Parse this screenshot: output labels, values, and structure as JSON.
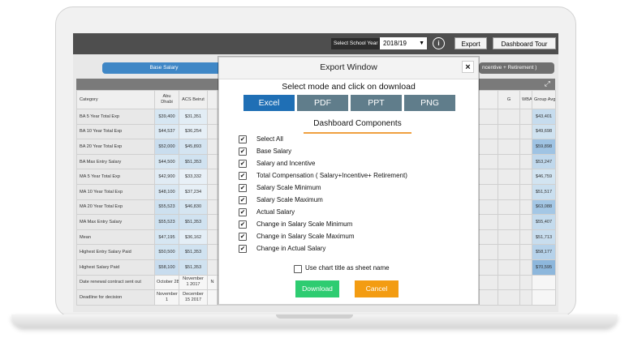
{
  "topbar": {
    "school_year_label": "Select School Year",
    "school_year_value": "2018/19",
    "export_label": "Export",
    "tour_label": "Dashboard Tour"
  },
  "tabs": {
    "base_salary": "Base Salary",
    "total_comp": "ncentive + Retirement )"
  },
  "table": {
    "headers": [
      "Category",
      "Abu Dhabi",
      "ACS Beirut",
      "G",
      "WBAIS",
      "Group Avg"
    ],
    "rows": [
      {
        "category": "BA 5 Year Total Exp",
        "c1": "$39,400",
        "c2": "$31,351",
        "avg": "$43,401"
      },
      {
        "category": "BA 10 Year Total Exp",
        "c1": "$44,537",
        "c2": "$36,254",
        "avg": "$49,698"
      },
      {
        "category": "BA 20 Year Total Exp",
        "c1": "$52,000",
        "c2": "$45,893",
        "avg": "$59,898"
      },
      {
        "category": "BA Max Entry Salary",
        "c1": "$44,500",
        "c2": "$51,353",
        "avg": "$53,247"
      },
      {
        "category": "MA 5 Year Total Exp",
        "c1": "$42,900",
        "c2": "$33,332",
        "avg": "$46,759"
      },
      {
        "category": "MA 10 Year Total Exp",
        "c1": "$48,100",
        "c2": "$37,234",
        "avg": "$51,517"
      },
      {
        "category": "MA 20 Year Total Exp",
        "c1": "$55,523",
        "c2": "$46,830",
        "avg": "$63,088"
      },
      {
        "category": "MA Max Entry Salary",
        "c1": "$55,523",
        "c2": "$51,353",
        "avg": "$55,407"
      },
      {
        "category": "Mean",
        "c1": "$47,195",
        "c2": "$36,162",
        "avg": "$51,713"
      },
      {
        "category": "Highest Entry Salary Paid",
        "c1": "$50,500",
        "c2": "$51,353",
        "avg": "$58,177"
      },
      {
        "category": "Highest Salary Paid",
        "c1": "$58,100",
        "c2": "$51,353",
        "avg": "$70,595"
      },
      {
        "category": "Date renewal contract sent out",
        "c1": "October 28",
        "c2": "November 1 2017",
        "c3": "N",
        "avg": ""
      },
      {
        "category": "Deadline for decision",
        "c1": "November 1",
        "c2": "December 15 2017",
        "c3": "",
        "avg": ""
      }
    ]
  },
  "modal": {
    "title": "Export Window",
    "close": "×",
    "subtitle": "Select mode and click on download",
    "modes": [
      "Excel",
      "PDF",
      "PPT",
      "PNG"
    ],
    "components_heading": "Dashboard Components",
    "components": [
      "Select All",
      "Base Salary",
      "Salary and Incentive",
      "Total Compensation ( Salary+Incentive+ Retirement)",
      "Salary Scale Minimum",
      "Salary Scale Maximum",
      "Actual Salary",
      "Change in Salary Scale Minimum",
      "Change in Salary Scale Maximum",
      "Change in Actual Salary"
    ],
    "chart_title_option": "Use chart title as sheet name",
    "download_label": "Download",
    "cancel_label": "Cancel"
  },
  "colors": {
    "topbar": "#4e4e4e",
    "tab_blue": "#3f87c6",
    "mode_active": "#1f6fb5",
    "mode_inactive": "#607d8b",
    "download": "#2ecc71",
    "cancel": "#f39c12"
  },
  "icons": {
    "info": "info-icon",
    "caret": "caret-down-icon",
    "expand": "expand-icon",
    "close": "close-icon",
    "check": "check-icon"
  }
}
